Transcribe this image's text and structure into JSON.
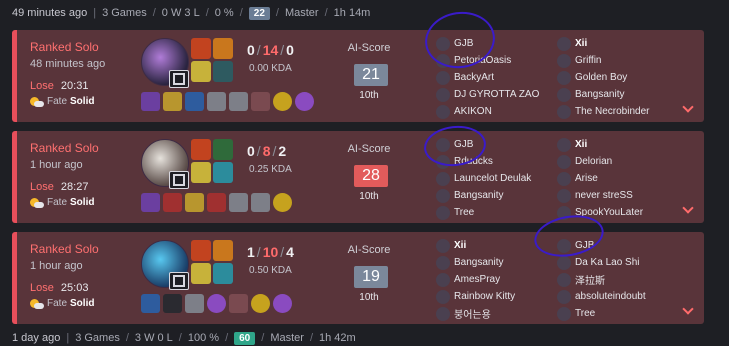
{
  "summary_top": {
    "ago": "49 minutes ago",
    "games": "3 Games",
    "record": "0 W 3 L",
    "winrate": "0 %",
    "ai_score": "22",
    "tier": "Master",
    "playtime": "1h 14m"
  },
  "summary_bottom": {
    "ago": "1 day ago",
    "games": "3 Games",
    "record": "3 W 0 L",
    "winrate": "100 %",
    "ai_score": "60",
    "tier": "Master",
    "playtime": "1h 42m"
  },
  "matches": [
    {
      "queue": "Ranked Solo",
      "ago": "48 minutes ago",
      "result": "Lose",
      "duration": "20:31",
      "fate_label": "Fate",
      "fate_value": "Solid",
      "kills": "0",
      "deaths": "14",
      "assists": "0",
      "kda": "0.00 KDA",
      "ai_label": "AI-Score",
      "ai_score": "21",
      "ai_rank": "10th",
      "team_blue": [
        "GJB",
        "PetoriaOasis",
        "BackyArt",
        "DJ GYROTTA ZAO",
        "AKIKON"
      ],
      "team_red": [
        "Xii",
        "Griffin",
        "Golden Boy",
        "Bangsanity",
        "The Necrobinder"
      ]
    },
    {
      "queue": "Ranked Solo",
      "ago": "1 hour ago",
      "result": "Lose",
      "duration": "28:27",
      "fate_label": "Fate",
      "fate_value": "Solid",
      "kills": "0",
      "deaths": "8",
      "assists": "2",
      "kda": "0.25 KDA",
      "ai_label": "AI-Score",
      "ai_score": "28",
      "ai_rank": "10th",
      "team_blue": [
        "GJB",
        "Rdudcks",
        "Launcelot Deulak",
        "Bangsanity",
        "Tree"
      ],
      "team_red": [
        "Xii",
        "Delorian",
        "Arise",
        "never streSS",
        "SpookYouLater"
      ]
    },
    {
      "queue": "Ranked Solo",
      "ago": "1 hour ago",
      "result": "Lose",
      "duration": "25:03",
      "fate_label": "Fate",
      "fate_value": "Solid",
      "kills": "1",
      "deaths": "10",
      "assists": "4",
      "kda": "0.50 KDA",
      "ai_label": "AI-Score",
      "ai_score": "19",
      "ai_rank": "10th",
      "team_blue": [
        "Xii",
        "Bangsanity",
        "AmesPray",
        "Rainbow Kitty",
        "붕어는용"
      ],
      "team_red": [
        "GJB",
        "Da Ka Lao Shi",
        "泽拉斯",
        "absoluteindoubt",
        "Tree"
      ]
    }
  ]
}
